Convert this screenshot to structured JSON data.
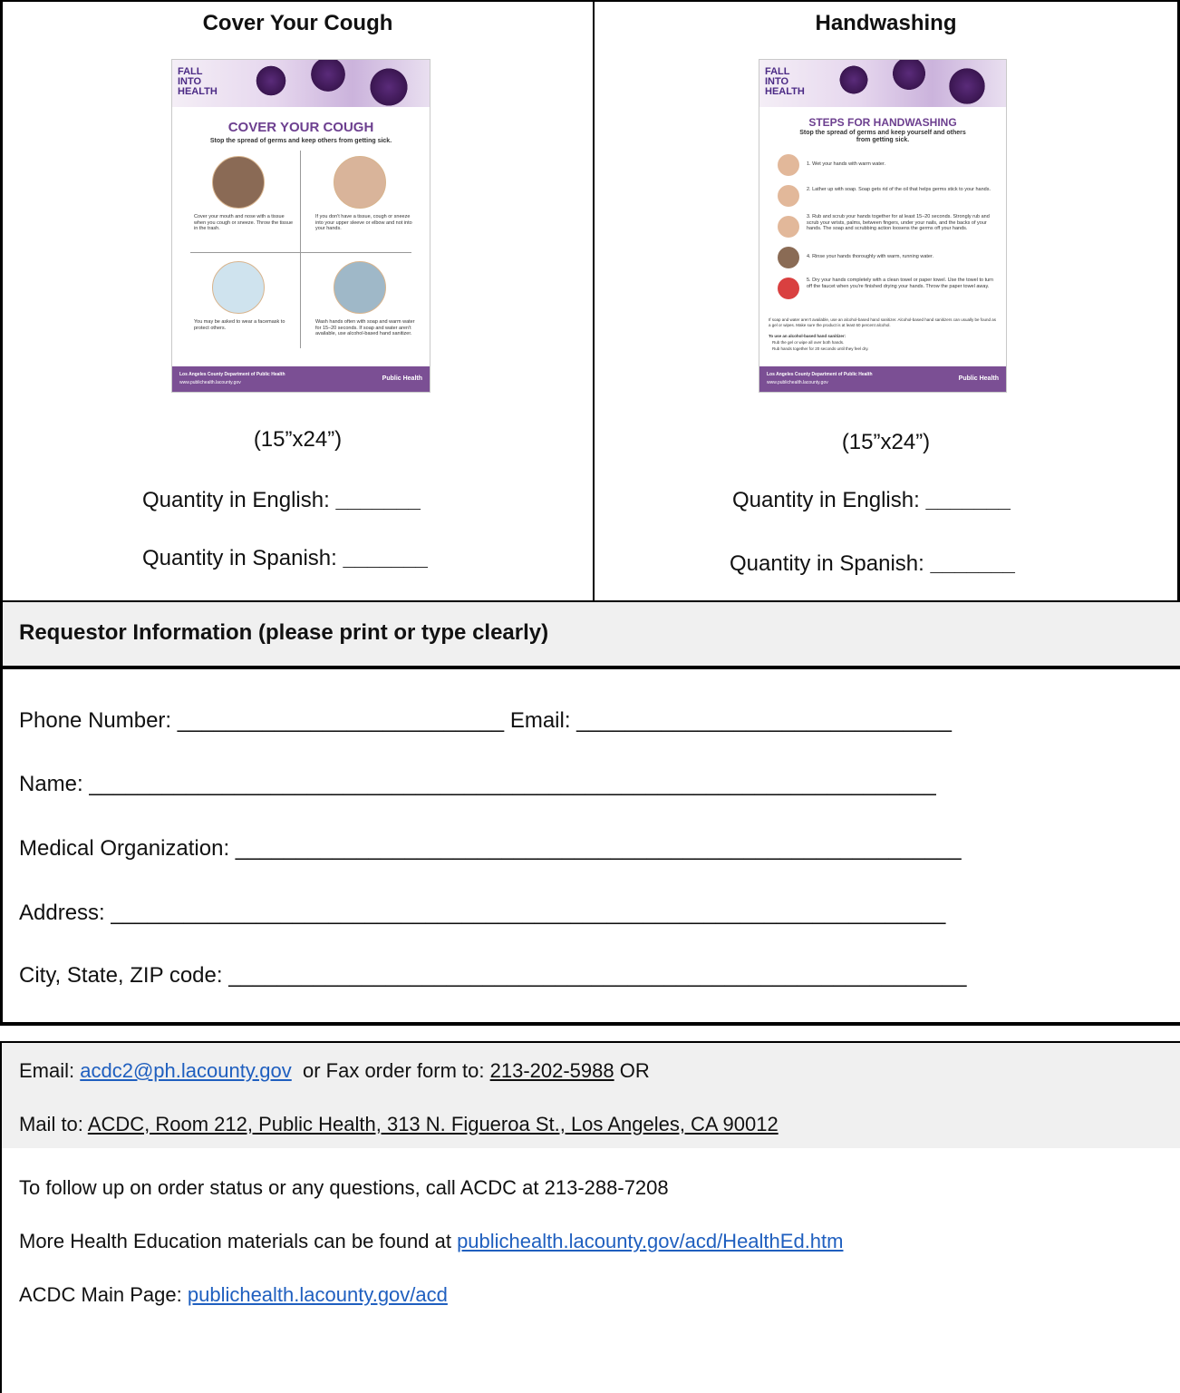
{
  "posters": [
    {
      "heading": "Cover Your Cough",
      "image": {
        "logo_lines": [
          "FALL",
          "INTO",
          "HEALTH"
        ],
        "title": "COVER YOUR COUGH",
        "subtitle": "Stop the spread of germs and keep others from getting sick.",
        "panels": [
          "Cover your mouth and nose with a tissue when you cough or sneeze. Throw the tissue in the trash.",
          "If you don't have a tissue, cough or sneeze into your upper sleeve or elbow and not into your hands.",
          "You may be asked to wear a facemask to protect others.",
          "Wash hands often with soap and warm water for 15–20 seconds. If soap and water aren't available, use alcohol-based hand sanitizer."
        ],
        "footer_org": "Los Angeles County Department of Public Health",
        "footer_url": "www.publichealth.lacounty.gov",
        "footer_logo": "Public Health"
      },
      "size": "(15”x24”)",
      "qty_english_label": "Quantity in English:",
      "qty_spanish_label": "Quantity in Spanish:",
      "blank": "_______"
    },
    {
      "heading": "Handwashing",
      "image": {
        "logo_lines": [
          "FALL",
          "INTO",
          "HEALTH"
        ],
        "title": "STEPS FOR HANDWASHING",
        "subtitle": "Stop the spread of germs and keep yourself and others from getting sick.",
        "steps": [
          "1. Wet your hands with warm water.",
          "2. Lather up with soap. Soap gets rid of the oil that helps germs stick to your hands.",
          "3. Rub and scrub your hands together for at least 15–20 seconds. Strongly rub and scrub your wrists, palms, between fingers, under your nails, and the backs of your hands. The soap and scrubbing action loosens the germs off your hands.",
          "4. Rinse your hands thoroughly with warm, running water.",
          "5. Dry your hands completely with a clean towel or paper towel. Use the towel to turn off the faucet when you're finished drying your hands. Throw the paper towel away."
        ],
        "note": "If soap and water aren't available, use an alcohol-based hand sanitizer. Alcohol-based hand sanitizers can usually be found as a gel or wipes. Make sure the product is at least 60 percent alcohol.",
        "sanitizer_title": "To use an alcohol-based hand sanitizer:",
        "sanitizer_steps": [
          "Rub the gel or wipe all over both hands.",
          "Rub hands together for 20 seconds until they feel dry."
        ],
        "footer_org": "Los Angeles County Department of Public Health",
        "footer_url": "www.publichealth.lacounty.gov",
        "footer_logo": "Public Health"
      },
      "size": "(15”x24”)",
      "qty_english_label": "Quantity in English:",
      "qty_spanish_label": "Quantity in Spanish:",
      "blank": "_______"
    }
  ],
  "requestor": {
    "header": "Requestor Information (please print or type clearly)",
    "phone_label": "Phone Number: ",
    "phone_blank": "___________________________",
    "email_label": " Email: ",
    "email_blank": "_______________________________",
    "name_label": "Name: ",
    "name_blank": "______________________________________________________________________",
    "org_label": "Medical Organization: ",
    "org_blank": "____________________________________________________________",
    "address_label": "Address: ",
    "address_blank": "_____________________________________________________________________",
    "city_label": "City, State, ZIP code: ",
    "city_blank": "_____________________________________________________________"
  },
  "contact": {
    "email_prefix": "Email: ",
    "email_link": "acdc2@ph.lacounty.gov",
    "fax_text": "  or Fax order form to: ",
    "fax_number": "213-202-5988",
    "or_text": " OR",
    "mail_prefix": "Mail to: ",
    "mail_address": "ACDC, Room 212, Public Health, 313 N. Figueroa St., Los Angeles, CA 90012",
    "followup": "To follow up on order status or any questions, call ACDC at 213-288-7208",
    "more_prefix": "More Health Education materials can be found at ",
    "more_link": "publichealth.lacounty.gov/acd/HealthEd.htm",
    "main_prefix": "ACDC Main Page: ",
    "main_link": "publichealth.lacounty.gov/acd"
  },
  "colors": {
    "link": "#1f5fbf",
    "poster_purple": "#7b4f94",
    "header_gray": "#f0f0f0"
  }
}
